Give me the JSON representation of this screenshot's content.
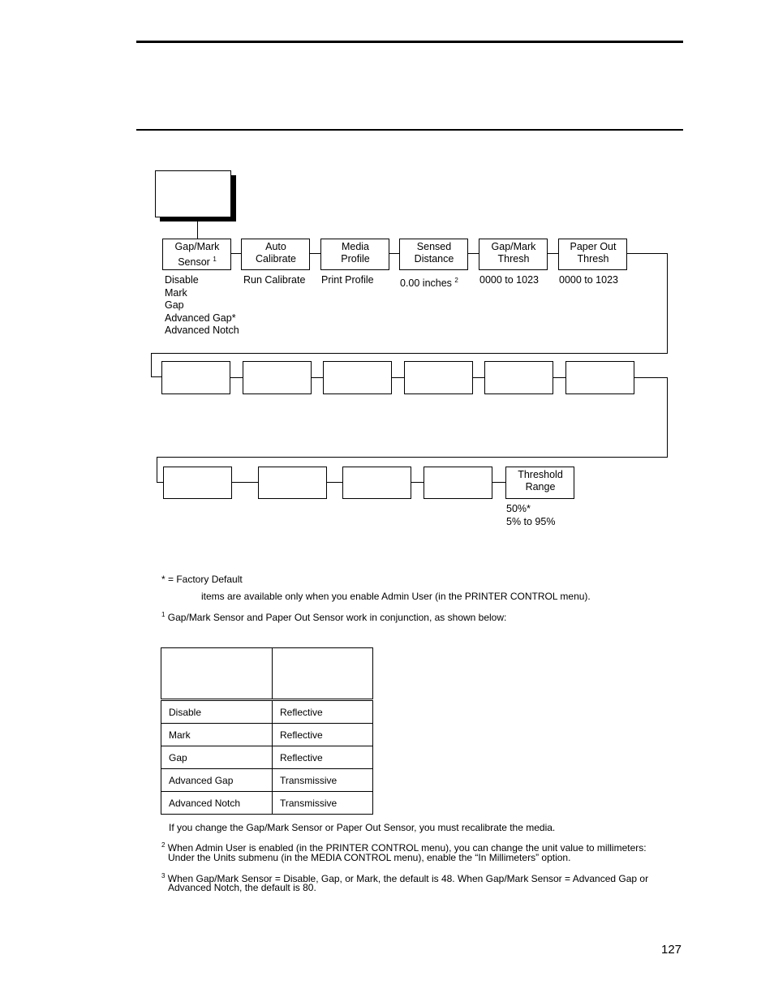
{
  "diagram": {
    "root_box_label": "",
    "row1": [
      {
        "label_lines": [
          "Gap/Mark",
          "Sensor"
        ],
        "footnote": "1",
        "options": [
          "Disable",
          "Mark",
          "Gap",
          "Advanced Gap*",
          "Advanced Notch"
        ]
      },
      {
        "label_lines": [
          "Auto",
          "Calibrate"
        ],
        "footnote": "",
        "options": [
          "Run Calibrate"
        ]
      },
      {
        "label_lines": [
          "Media",
          "Profile"
        ],
        "footnote": "",
        "options": [
          "Print Profile"
        ]
      },
      {
        "label_lines": [
          "Sensed",
          "Distance"
        ],
        "footnote": "",
        "options": [
          "0.00 inches"
        ],
        "option_footnote": "2"
      },
      {
        "label_lines": [
          "Gap/Mark",
          "Thresh"
        ],
        "footnote": "",
        "options": [
          "0000 to 1023"
        ]
      },
      {
        "label_lines": [
          "Paper Out",
          "Thresh"
        ],
        "footnote": "",
        "options": [
          "0000 to 1023"
        ]
      }
    ],
    "row2": [
      {
        "label_lines": [
          "",
          ""
        ]
      },
      {
        "label_lines": [
          "",
          ""
        ]
      },
      {
        "label_lines": [
          "",
          ""
        ]
      },
      {
        "label_lines": [
          "",
          ""
        ]
      },
      {
        "label_lines": [
          "",
          ""
        ]
      },
      {
        "label_lines": [
          "",
          ""
        ]
      }
    ],
    "row3": [
      {
        "label_lines": [
          "",
          ""
        ]
      },
      {
        "label_lines": [
          "",
          ""
        ]
      },
      {
        "label_lines": [
          "",
          ""
        ]
      },
      {
        "label_lines": [
          "",
          ""
        ]
      },
      {
        "label_lines": [
          "Threshold",
          "Range"
        ],
        "options": [
          "50%*",
          "5% to 95%"
        ]
      }
    ]
  },
  "notes": {
    "factory_default": "* = Factory Default",
    "admin_items": "items are available only when you enable Admin User (in the PRINTER CONTROL menu).",
    "footnote1_mark": "1",
    "footnote1": "Gap/Mark Sensor and Paper Out Sensor work in conjunction, as shown below:"
  },
  "sensor_table": {
    "headers": [
      "",
      ""
    ],
    "rows": [
      [
        "Disable",
        "Reflective"
      ],
      [
        "Mark",
        "Reflective"
      ],
      [
        "Gap",
        "Reflective"
      ],
      [
        "Advanced Gap",
        "Transmissive"
      ],
      [
        "Advanced Notch",
        "Transmissive"
      ]
    ]
  },
  "footer_notes": {
    "recalibrate": "If you change the Gap/Mark Sensor or Paper Out Sensor, you must recalibrate the media.",
    "footnote2_mark": "2",
    "footnote2_line1": "When Admin User is enabled (in the PRINTER CONTROL menu), you can change the unit value to millimeters:",
    "footnote2_line2": "Under the Units submenu (in the MEDIA CONTROL menu), enable the “In Millimeters” option.",
    "footnote3_mark": "3",
    "footnote3_line1": "When Gap/Mark Sensor = Disable, Gap, or Mark, the default is 48. When Gap/Mark Sensor = Advanced Gap or",
    "footnote3_line2": "Advanced Notch, the default is 80."
  },
  "page_number": "127"
}
